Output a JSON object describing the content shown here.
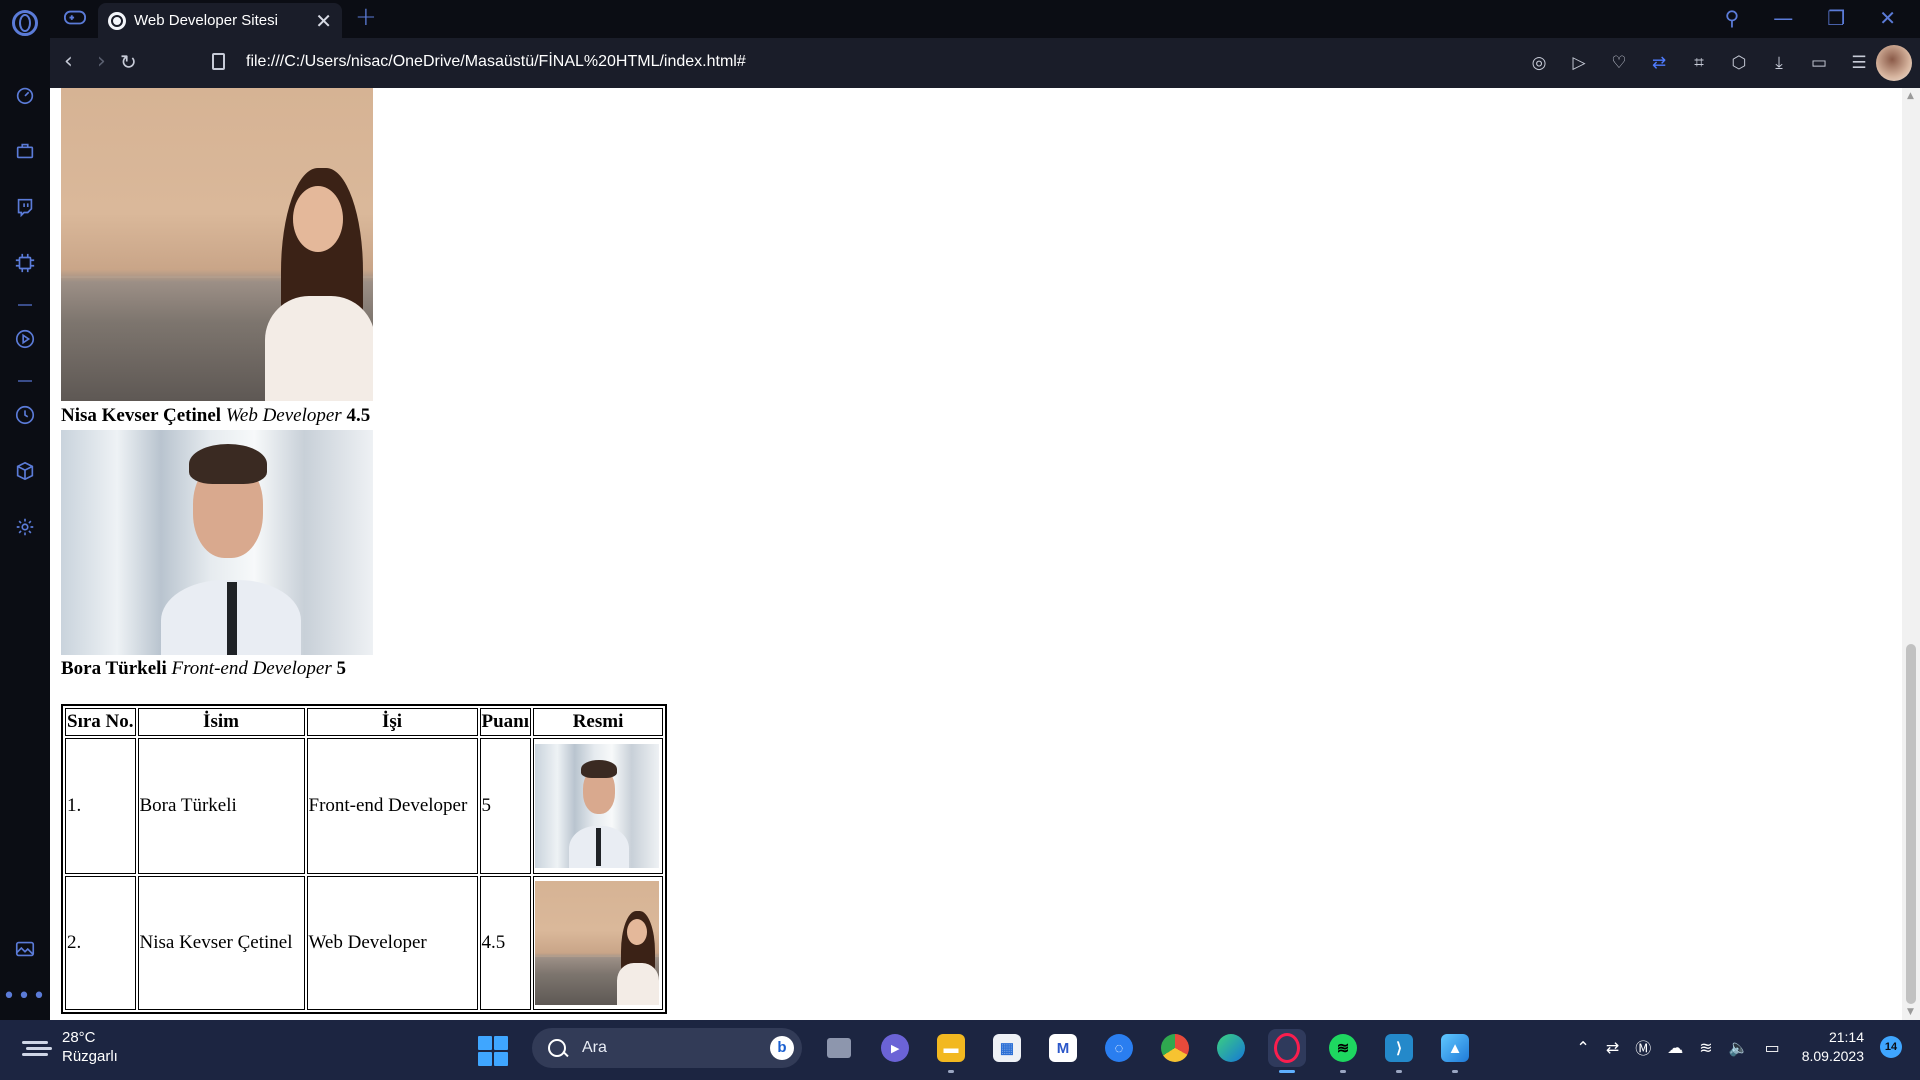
{
  "browser": {
    "tab_title": "Web Developer Sitesi",
    "url": "file:///C:/Users/nisac/OneDrive/Masaüstü/FİNAL%20HTML/index.html#",
    "accent_color": "#5b7bd8"
  },
  "page": {
    "profiles": [
      {
        "name": "Nisa Kevser Çetinel",
        "job": "Web Developer",
        "score": "4.5"
      },
      {
        "name": "Bora Türkeli",
        "job": "Front-end Developer",
        "score": "5"
      }
    ],
    "table": {
      "headers": [
        "Sıra No.",
        "İsim",
        "İşi",
        "Puanı",
        "Resmi"
      ],
      "rows": [
        {
          "no": "1.",
          "name": "Bora Türkeli",
          "job": "Front-end Developer",
          "score": "5",
          "photo": "bora-photo"
        },
        {
          "no": "2.",
          "name": "Nisa Kevser Çetinel",
          "job": "Web Developer",
          "score": "4.5",
          "photo": "nisa-photo"
        }
      ]
    }
  },
  "taskbar": {
    "weather_temp": "28°C",
    "weather_desc": "Rüzgarlı",
    "search_placeholder": "Ara",
    "time": "21:14",
    "date": "8.09.2023",
    "notification_count": "14"
  }
}
